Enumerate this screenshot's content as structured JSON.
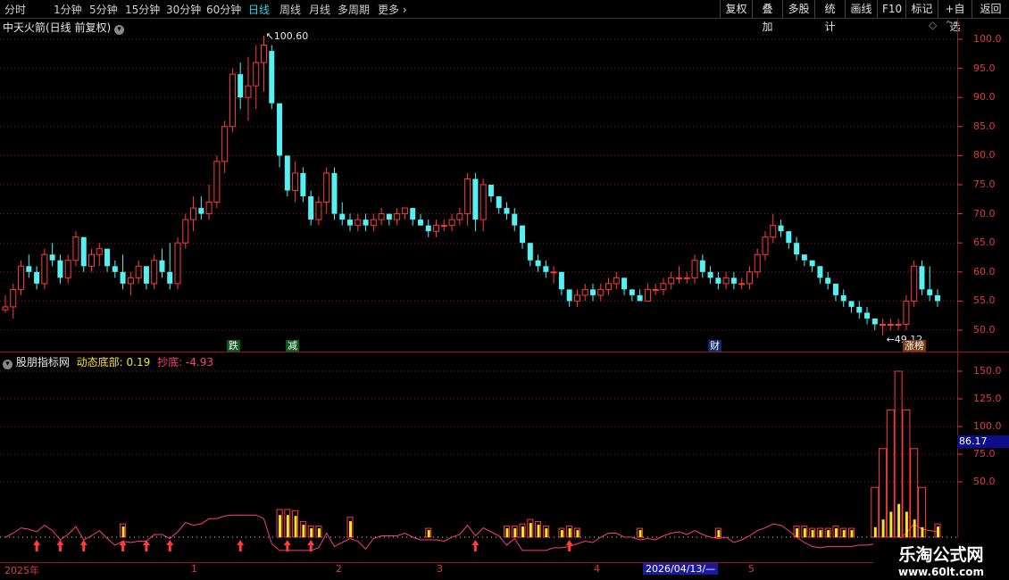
{
  "toolbar": {
    "tabs": [
      "分时",
      "1分钟",
      "5分钟",
      "15分钟",
      "30分钟",
      "60分钟",
      "日线",
      "周线",
      "月线",
      "多周期",
      "更多"
    ],
    "active_tab": "日线",
    "buttons": [
      "复权",
      "叠加",
      "多股",
      "统计",
      "画线",
      "F10",
      "标记",
      "+自选",
      "返回"
    ]
  },
  "main_panel": {
    "title": "中天火箭(日线 前复权)",
    "high_label": "100.60",
    "low_label": "49.12",
    "badges": [
      "跌",
      "减",
      "财",
      "涨榜"
    ]
  },
  "indicator_panel": {
    "name": "股朋指标网",
    "series1_label": "动态底部: 0.19",
    "series2_label": "抄底: -4.93",
    "current_value": "86.17"
  },
  "date_axis": {
    "labels": [
      "2025年",
      "1",
      "2",
      "3",
      "4",
      "2026/04/13/—",
      "5"
    ]
  },
  "watermark": {
    "name": "乐淘公式网",
    "url": "www.60lt.com"
  },
  "colors": {
    "up": "#ff3b3b",
    "down": "#54f0f2",
    "yellow": "#f5e326",
    "pink": "#ff3c7c",
    "grid": "#8a1b1b"
  },
  "chart_data": [
    {
      "type": "candlestick",
      "title": "中天火箭(日线 前复权)",
      "ylim": [
        47,
        103
      ],
      "yticks": [
        50,
        55,
        60,
        65,
        70,
        75,
        80,
        85,
        90,
        95,
        100
      ],
      "annotations": [
        {
          "label": "100.60",
          "value": 100.6
        },
        {
          "label": "49.12",
          "value": 49.12
        }
      ],
      "ohlc": [
        [
          53.5,
          56,
          53,
          54
        ],
        [
          54,
          58,
          52,
          57
        ],
        [
          57,
          62,
          56,
          61
        ],
        [
          61,
          63,
          59,
          60
        ],
        [
          60,
          61,
          57,
          58
        ],
        [
          58,
          64,
          57,
          63
        ],
        [
          63,
          65,
          61,
          62
        ],
        [
          62,
          63,
          58,
          59
        ],
        [
          59,
          63,
          58,
          62
        ],
        [
          62,
          67,
          61,
          66
        ],
        [
          66,
          66,
          60,
          61
        ],
        [
          61,
          64,
          60,
          63
        ],
        [
          63,
          65,
          61,
          64
        ],
        [
          64,
          64,
          60,
          61
        ],
        [
          61,
          62,
          59,
          60
        ],
        [
          60,
          63,
          57,
          58
        ],
        [
          58,
          60,
          56,
          59
        ],
        [
          59,
          62,
          58,
          61
        ],
        [
          61,
          61,
          57,
          58
        ],
        [
          58,
          63,
          57,
          62
        ],
        [
          62,
          64,
          59,
          60
        ],
        [
          60,
          65,
          57,
          58
        ],
        [
          58,
          66,
          57,
          65
        ],
        [
          65,
          70,
          64,
          69
        ],
        [
          69,
          73,
          67,
          71
        ],
        [
          71,
          73,
          69,
          70
        ],
        [
          70,
          75,
          69,
          72
        ],
        [
          72,
          80,
          71,
          79
        ],
        [
          79,
          86,
          77,
          85
        ],
        [
          85,
          95,
          84,
          94
        ],
        [
          94,
          96,
          88,
          90
        ],
        [
          90,
          97,
          86,
          92
        ],
        [
          92,
          99,
          88,
          96
        ],
        [
          96,
          100.6,
          91,
          99
        ],
        [
          98,
          99,
          88,
          89
        ],
        [
          89,
          85,
          78,
          80
        ],
        [
          80,
          80,
          73,
          74
        ],
        [
          74,
          79,
          72,
          77
        ],
        [
          77,
          78,
          72,
          73
        ],
        [
          73,
          74,
          68,
          69
        ],
        [
          69,
          73,
          68,
          72
        ],
        [
          72,
          78,
          70,
          77
        ],
        [
          77,
          78,
          69,
          70
        ],
        [
          70,
          72,
          68,
          69
        ],
        [
          69,
          70,
          67,
          68
        ],
        [
          68,
          70,
          67,
          69
        ],
        [
          69,
          70,
          67,
          68
        ],
        [
          68,
          70,
          67,
          69
        ],
        [
          69,
          71,
          68,
          70
        ],
        [
          70,
          70,
          68,
          69
        ],
        [
          69,
          71,
          68,
          70
        ],
        [
          70,
          71,
          69,
          71
        ],
        [
          71,
          71,
          68,
          69
        ],
        [
          69,
          70,
          68,
          68
        ],
        [
          68,
          69,
          66,
          67
        ],
        [
          67,
          69,
          66,
          68
        ],
        [
          68,
          69,
          67,
          68
        ],
        [
          68,
          70,
          67,
          69
        ],
        [
          69,
          71,
          68,
          70
        ],
        [
          70,
          77,
          68,
          76
        ],
        [
          76,
          77,
          67,
          69
        ],
        [
          69,
          76,
          67,
          75
        ],
        [
          75,
          75,
          72,
          73
        ],
        [
          73,
          73,
          70,
          71
        ],
        [
          71,
          72,
          69,
          70
        ],
        [
          70,
          71,
          67,
          68
        ],
        [
          68,
          68,
          64,
          65
        ],
        [
          65,
          65,
          61,
          62
        ],
        [
          62,
          63,
          60,
          61
        ],
        [
          61,
          62,
          59,
          60
        ],
        [
          60,
          61,
          58,
          60
        ],
        [
          60,
          60,
          56,
          57
        ],
        [
          57,
          57,
          54,
          55
        ],
        [
          55,
          57,
          54,
          56
        ],
        [
          56,
          58,
          55,
          57
        ],
        [
          57,
          58,
          55,
          56
        ],
        [
          56,
          58,
          55,
          57
        ],
        [
          57,
          59,
          56,
          58
        ],
        [
          58,
          60,
          57,
          59
        ],
        [
          59,
          59,
          56,
          57
        ],
        [
          57,
          57,
          55,
          56
        ],
        [
          56,
          57,
          55,
          55
        ],
        [
          55,
          58,
          55,
          57
        ],
        [
          57,
          58,
          56,
          57
        ],
        [
          57,
          59,
          56,
          58
        ],
        [
          58,
          60,
          57,
          59
        ],
        [
          59,
          61,
          58,
          59
        ],
        [
          59,
          60,
          58,
          59
        ],
        [
          59,
          63,
          58,
          62
        ],
        [
          62,
          63,
          59,
          60
        ],
        [
          60,
          61,
          58,
          59
        ],
        [
          59,
          60,
          57,
          58
        ],
        [
          58,
          60,
          57,
          59
        ],
        [
          59,
          60,
          57,
          58
        ],
        [
          58,
          59,
          57,
          58
        ],
        [
          58,
          61,
          57,
          60
        ],
        [
          60,
          64,
          59,
          63
        ],
        [
          63,
          67,
          62,
          66
        ],
        [
          66,
          70,
          65,
          68
        ],
        [
          68,
          69,
          66,
          67
        ],
        [
          67,
          67,
          64,
          65
        ],
        [
          65,
          66,
          62,
          63
        ],
        [
          63,
          63,
          61,
          62
        ],
        [
          62,
          62,
          60,
          61
        ],
        [
          61,
          61,
          58,
          59
        ],
        [
          59,
          60,
          57,
          58
        ],
        [
          58,
          58,
          55,
          56
        ],
        [
          56,
          57,
          54,
          55
        ],
        [
          55,
          55,
          53,
          54
        ],
        [
          54,
          55,
          52,
          53
        ],
        [
          53,
          54,
          51,
          52
        ],
        [
          52,
          52,
          50,
          51
        ],
        [
          51,
          52,
          49.12,
          51
        ],
        [
          51,
          52,
          50,
          51
        ],
        [
          51,
          52,
          50,
          51
        ],
        [
          51,
          56,
          50,
          55
        ],
        [
          55,
          62,
          54,
          61
        ],
        [
          61,
          62,
          56,
          57
        ],
        [
          57,
          61,
          55,
          56
        ],
        [
          56,
          57,
          54,
          55
        ]
      ]
    },
    {
      "type": "bar",
      "title": "股朋指标网",
      "ylim": [
        -15,
        160
      ],
      "yticks": [
        50,
        75,
        100,
        125,
        150
      ],
      "current_value": 86.17,
      "series": [
        {
          "name": "动态底部",
          "values": [
            0,
            0,
            0,
            0,
            0,
            0,
            0,
            0,
            0,
            0,
            0,
            0,
            0,
            0,
            0,
            0,
            0,
            0,
            0,
            0,
            0,
            0,
            0,
            0,
            0,
            0,
            0,
            0,
            0,
            0,
            0,
            0,
            0,
            0,
            0,
            0,
            0,
            0,
            0,
            0,
            0,
            0,
            0,
            0,
            0,
            0,
            0,
            0,
            0,
            0,
            0,
            0,
            0,
            0,
            0,
            0,
            0,
            0,
            0,
            0,
            0,
            0,
            0,
            0,
            0,
            0,
            0,
            0,
            0,
            0,
            0,
            0,
            0,
            0,
            0,
            0,
            0,
            0,
            0,
            0,
            0,
            0,
            0,
            0,
            0,
            0,
            0,
            0,
            0,
            0,
            0,
            0,
            0,
            0,
            0,
            0,
            0,
            0,
            0,
            0,
            0,
            0,
            0,
            0,
            0,
            0,
            0,
            0,
            0,
            0,
            0,
            0,
            0,
            0,
            0,
            0,
            0,
            0,
            0,
            0,
            0
          ]
        },
        {
          "name": "抄底",
          "values": [
            -4.93
          ]
        }
      ]
    }
  ]
}
